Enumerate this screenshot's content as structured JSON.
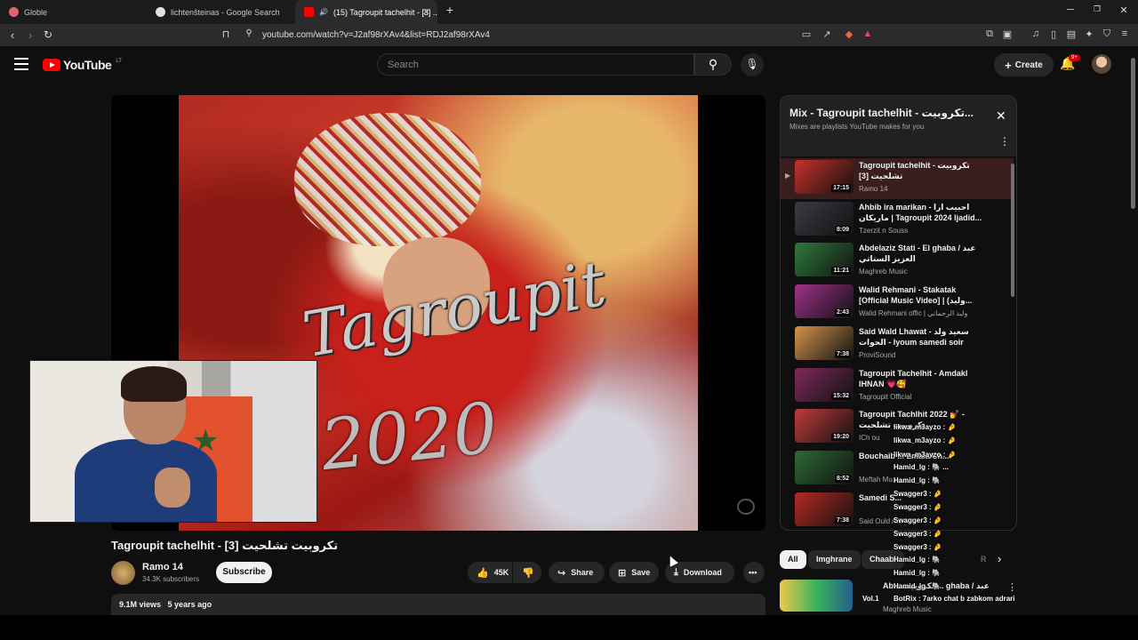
{
  "browser": {
    "tabs": [
      {
        "label": "Globle",
        "favicon_color": "#e0626a"
      },
      {
        "label": "lichtenšteinas - Google Search",
        "favicon_color": "#e0e0e0"
      },
      {
        "label": "(15) Tagroupit tachelhit - [3] ...",
        "favicon_color": "#ff0000"
      }
    ],
    "new_tab": "+",
    "url": "youtube.com/watch?v=J2af98rXAv4&list=RDJ2af98rXAv4"
  },
  "header": {
    "logo": "YouTube",
    "country": "LT",
    "search_placeholder": "Search",
    "create_label": "Create",
    "notifications_badge": "9+"
  },
  "video": {
    "title": "Tagroupit tachelhit - [3] تكروبيت تشلحيت",
    "art_title": "Tagroupit",
    "art_year": "2020",
    "channel": "Ramo 14",
    "subscribers": "34.3K subscribers",
    "subscribe_label": "Subscribe",
    "likes": "45K",
    "share_label": "Share",
    "save_label": "Save",
    "download_label": "Download",
    "views": "9.1M views",
    "age": "5 years ago"
  },
  "playlist": {
    "title": "Mix - Tagroupit tachelhit - تكروبيت...",
    "subtitle": "Mixes are playlists YouTube makes for you",
    "items": [
      {
        "title": "Tagroupit tachelhit - تكروبيت تشلحيت [3]",
        "channel": "Ramo 14",
        "duration": "17:15",
        "thumb": "#c9312b",
        "selected": true
      },
      {
        "title": "Ahbib ira marikan - احبيب ارا ماريكان | Tagroupit 2024 ljadid...",
        "channel": "Tzerzit n Souss",
        "duration": "8:09",
        "thumb": "#3e3a44"
      },
      {
        "title": "Abdelaziz Stati - El ghaba / عبد العزيز الستاتي",
        "channel": "Maghreb Music",
        "duration": "11:21",
        "thumb": "#2f7a3c"
      },
      {
        "title": "Walid Rehmani - Stakatak [Official Music Video] | (وليد...",
        "channel": "Walid Rehmani offic | وليد الرحماني",
        "duration": "2:43",
        "thumb": "#a0328a"
      },
      {
        "title": "Said Wald Lhawat - سعيد ولد الحوات - lyoum samedi soir",
        "channel": "ProviSound",
        "duration": "7:38",
        "thumb": "#d4944b"
      },
      {
        "title": "Tagroupit Tachelhit - Amdakl IHNAN 💗🥰",
        "channel": "Tagroupit Official",
        "duration": "15:32",
        "thumb": "#7e2a5a"
      },
      {
        "title": "Tagroupit Tachlhit 2022 💅 - تكروبيت تشلحيت",
        "channel": "ICh ou",
        "duration": "19:20",
        "thumb": "#c23b3b"
      },
      {
        "title": "Bouchaib ... Lmala Ch...",
        "channel": "Meftah Mu...",
        "duration": "8:52",
        "thumb": "#2c6a34"
      },
      {
        "title": "Samedi S...",
        "channel": "Said Ould A...",
        "duration": "7:38",
        "thumb": "#b72a22"
      }
    ]
  },
  "chips": [
    "All",
    "Imghrane",
    "Chaabi",
    "R"
  ],
  "recommendation": {
    "title": "Ab... تكروبيت ... ghaba / عبد",
    "channel": "Maghreb Music",
    "vol": "Vol.1"
  },
  "chat": [
    "likwa_m3ayzo : 🤌",
    "likwa_m3ayzo : 🤌",
    "likwa_m3ayzo : 🤌",
    "Hamid_lg : 🐘 ...",
    "Hamid_lg : 🐘",
    "Swagger3 : 🤌",
    "Swagger3 : 🤌",
    "Swagger3 : 🤌",
    "Swagger3 : 🤌",
    "Swagger3 : 🤌",
    "Hamid_lg : 🐘",
    "Hamid_lg : 🐘",
    "Hamid_lg : 🐘",
    "BotRix : 7arko chat b zabkom adrari"
  ]
}
